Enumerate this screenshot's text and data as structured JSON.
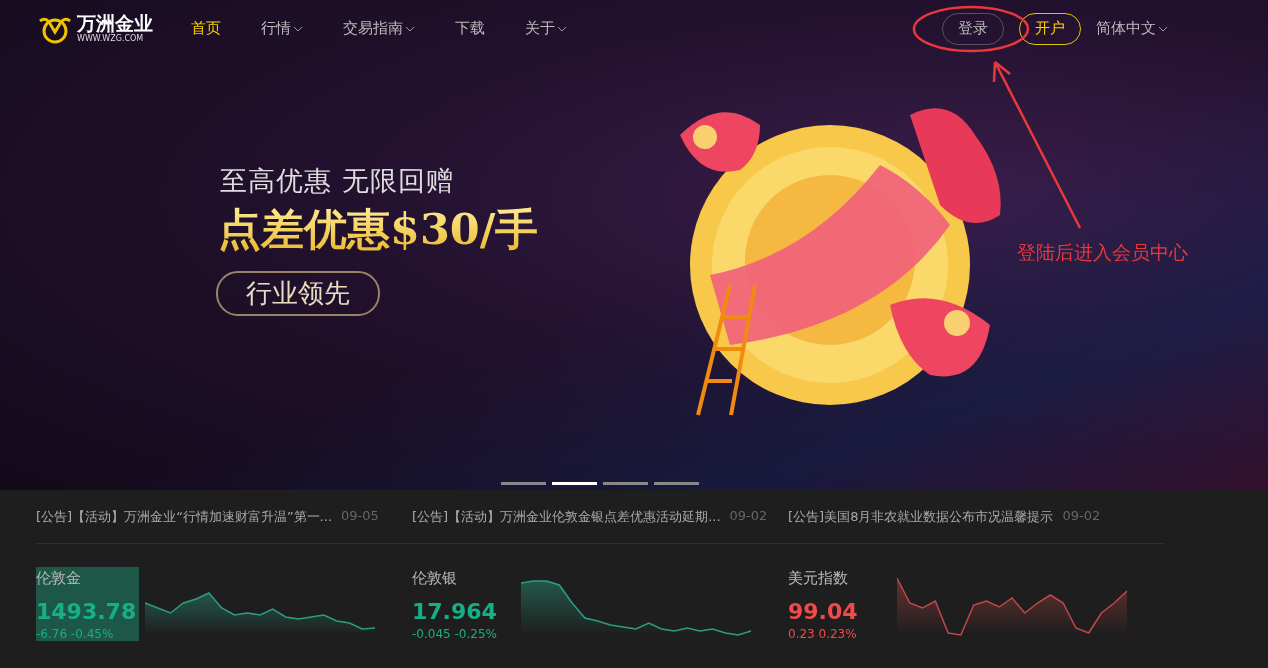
{
  "logo": {
    "name": "万洲金业",
    "url": "WWW.WZG.COM"
  },
  "nav": [
    {
      "label": "首页",
      "selected": true,
      "dropdown": false
    },
    {
      "label": "行情",
      "selected": false,
      "dropdown": true
    },
    {
      "label": "交易指南",
      "selected": false,
      "dropdown": true
    },
    {
      "label": "下载",
      "selected": false,
      "dropdown": false
    },
    {
      "label": "关于",
      "selected": false,
      "dropdown": true
    }
  ],
  "actions": [
    {
      "label": "登录",
      "kind": "outline"
    },
    {
      "label": "开户",
      "kind": "accent"
    }
  ],
  "language": {
    "label": "简体中文"
  },
  "banner": {
    "subtitle": "至高优惠 无限回赠",
    "headline": "点差优惠$30/手",
    "badge": "行业领先"
  },
  "carousel": [
    {
      "selected": false
    },
    {
      "selected": true
    },
    {
      "selected": false
    },
    {
      "selected": false
    }
  ],
  "annotation": {
    "text": "登陆后进入会员中心"
  },
  "news": [
    {
      "title": "[公告]【活动】万洲金业“行情加速财富升温”第一...",
      "date": "09-05"
    },
    {
      "title": "[公告]【活动】万洲金业伦敦金银点差优惠活动延期...",
      "date": "09-02"
    },
    {
      "title": "[公告]美国8月非农就业数据公布市况温馨提示",
      "date": "09-02"
    }
  ],
  "tickers": [
    {
      "name": "伦敦金",
      "price": "1493.78",
      "change": "-6.76 -0.45%",
      "kind": "down",
      "selected": true
    },
    {
      "name": "伦敦银",
      "price": "17.964",
      "change": "-0.045 -0.25%",
      "kind": "down",
      "selected": false
    },
    {
      "name": "美元指数",
      "price": "99.04",
      "change": "0.23 0.23%",
      "kind": "up",
      "selected": false
    }
  ]
}
